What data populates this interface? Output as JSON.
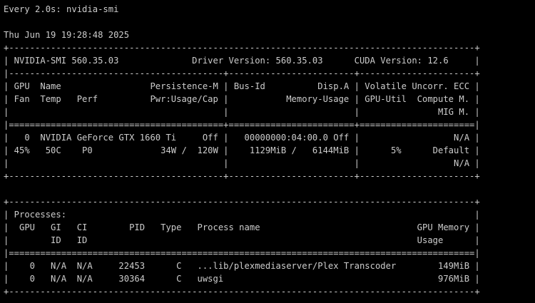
{
  "header": {
    "watch": "Every 2.0s: nvidia-smi",
    "timestamp": "Thu Jun 19 19:28:48 2025"
  },
  "colors": {
    "background": "#000000",
    "text": "#cccccc"
  },
  "smi_table": [
    "+-----------------------------------------------------------------------------------------+",
    "| NVIDIA-SMI 560.35.03              Driver Version: 560.35.03      CUDA Version: 12.6     |",
    "|-----------------------------------------+------------------------+----------------------+",
    "| GPU  Name                 Persistence-M | Bus-Id          Disp.A | Volatile Uncorr. ECC |",
    "| Fan  Temp   Perf          Pwr:Usage/Cap |           Memory-Usage | GPU-Util  Compute M. |",
    "|                                         |                        |               MIG M. |",
    "|=========================================+========================+======================|",
    "|   0  NVIDIA GeForce GTX 1660 Ti     Off |   00000000:04:00.0 Off |                  N/A |",
    "| 45%   50C    P0             34W /  120W |    1129MiB /   6144MiB |      5%      Default |",
    "|                                         |                        |                  N/A |",
    "+-----------------------------------------+------------------------+----------------------+"
  ],
  "processes_table": [
    "+-----------------------------------------------------------------------------------------+",
    "| Processes:                                                                              |",
    "|  GPU   GI   CI        PID   Type   Process name                              GPU Memory |",
    "|        ID   ID                                                               Usage      |",
    "|=========================================================================================|",
    "|    0   N/A  N/A     22453      C   ...lib/plexmediaserver/Plex Transcoder        149MiB |",
    "|    0   N/A  N/A     30364      C   uwsgi                                         976MiB |",
    "+-----------------------------------------------------------------------------------------+"
  ]
}
